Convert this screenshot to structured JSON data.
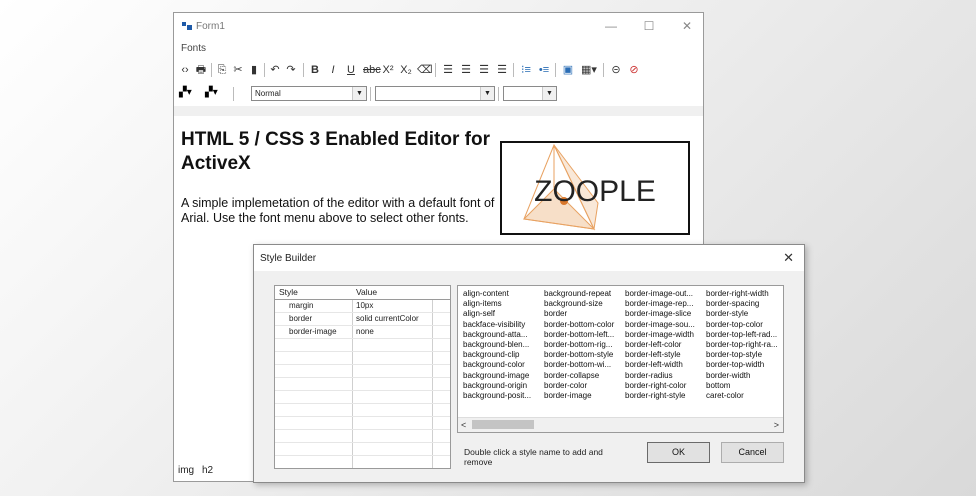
{
  "window": {
    "title": "Form1",
    "menu": "Fonts",
    "controls": {
      "minimize": "—",
      "maximize": "☐",
      "close": "✕"
    }
  },
  "toolbar": {
    "icons": [
      "source-view-icon",
      "print-icon",
      "copy-icon",
      "cut-icon",
      "paste-icon",
      "undo-icon",
      "redo-icon",
      "bold-icon",
      "italic-icon",
      "underline-icon",
      "strikethrough-icon",
      "superscript-icon",
      "subscript-icon",
      "eraser-icon",
      "align-left-icon",
      "align-center-icon",
      "align-right-icon",
      "justify-icon",
      "ordered-list-icon",
      "unordered-list-icon",
      "insert-image-icon",
      "insert-table-icon",
      "link-icon",
      "unlink-icon"
    ]
  },
  "format_bar": {
    "block_format": "Normal",
    "font_name": "",
    "font_size": ""
  },
  "editor": {
    "heading": "HTML 5 / CSS 3 Enabled Editor for ActiveX",
    "paragraph": "A simple implemetation of the editor with a default font of Arial. Use the font menu above to select other fonts.",
    "logo_text": "ZOOPLE"
  },
  "status": {
    "tag1": "img",
    "tag2": "h2"
  },
  "style_builder": {
    "title": "Style Builder",
    "close": "✕",
    "headers": {
      "style": "Style",
      "value": "Value"
    },
    "rows": [
      {
        "style": "margin",
        "value": "10px"
      },
      {
        "style": "border",
        "value": "solid currentColor"
      },
      {
        "style": "border-image",
        "value": "none"
      }
    ],
    "columns": [
      [
        "align-content",
        "align-items",
        "align-self",
        "backface-visibility",
        "background-atta...",
        "background-blen...",
        "background-clip",
        "background-color",
        "background-image",
        "background-origin",
        "background-posit..."
      ],
      [
        "background-repeat",
        "background-size",
        "border",
        "border-bottom-color",
        "border-bottom-left...",
        "border-bottom-rig...",
        "border-bottom-style",
        "border-bottom-wi...",
        "border-collapse",
        "border-color",
        "border-image"
      ],
      [
        "border-image-out...",
        "border-image-rep...",
        "border-image-slice",
        "border-image-sou...",
        "border-image-width",
        "border-left-color",
        "border-left-style",
        "border-left-width",
        "border-radius",
        "border-right-color",
        "border-right-style"
      ],
      [
        "border-right-width",
        "border-spacing",
        "border-style",
        "border-top-color",
        "border-top-left-rad...",
        "border-top-right-ra...",
        "border-top-style",
        "border-top-width",
        "border-width",
        "bottom",
        "caret-color"
      ]
    ],
    "hint": "Double click a style name to add and remove",
    "ok": "OK",
    "cancel": "Cancel",
    "scroll_left": "<",
    "scroll_right": ">"
  },
  "colors": {
    "logo_accent": "#e8a262",
    "logo_border": "#111111",
    "app_icon": "#1e5aa8"
  }
}
